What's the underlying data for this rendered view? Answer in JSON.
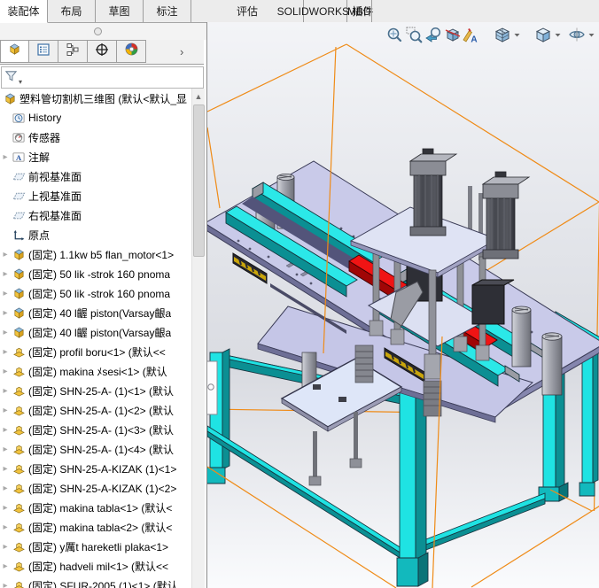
{
  "ribbon_tabs": [
    {
      "label": "装配体",
      "active": true
    },
    {
      "label": "布局",
      "active": false
    },
    {
      "label": "草图",
      "active": false
    },
    {
      "label": "标注",
      "active": false
    },
    {
      "label": "评估",
      "active": false
    },
    {
      "label": "SOLIDWORKS 插件",
      "active": false
    },
    {
      "label": "MBD",
      "active": false
    }
  ],
  "panel_tabs": [
    "featuremanager-design-tree",
    "propertymanager",
    "configurationmanager",
    "dimxpertmanager",
    "displaymanager"
  ],
  "filter": {
    "value": "",
    "placeholder": ""
  },
  "tree": {
    "root": {
      "icon": "assembly",
      "label": "塑料管切割机三维图  (默认<默认_显"
    },
    "items": [
      {
        "icon": "history",
        "arrow": false,
        "label": "History"
      },
      {
        "icon": "sensor",
        "arrow": false,
        "label": "传感器"
      },
      {
        "icon": "annotation",
        "arrow": true,
        "label": "注解"
      },
      {
        "icon": "plane",
        "arrow": false,
        "label": "前视基准面"
      },
      {
        "icon": "plane",
        "arrow": false,
        "label": "上视基准面"
      },
      {
        "icon": "plane",
        "arrow": false,
        "label": "右视基准面"
      },
      {
        "icon": "origin",
        "arrow": false,
        "label": "原点"
      },
      {
        "icon": "part-cube",
        "arrow": true,
        "label": "(固定) 1.1kw b5 flan_motor<1>"
      },
      {
        "icon": "part-cube",
        "arrow": true,
        "label": "(固定) 50 lik -strok 160 pnoma"
      },
      {
        "icon": "part-cube",
        "arrow": true,
        "label": "(固定) 50 lik -strok 160 pnoma"
      },
      {
        "icon": "part-cube",
        "arrow": true,
        "label": "(固定) 40 l齷 piston(Varsay齦a"
      },
      {
        "icon": "part-cube",
        "arrow": true,
        "label": "(固定) 40 l齷 piston(Varsay齦a"
      },
      {
        "icon": "part-block",
        "arrow": true,
        "label": "(固定) profil boru<1> (默认<<"
      },
      {
        "icon": "part-block",
        "arrow": true,
        "label": "(固定) makina ﾒsesi<1> (默认"
      },
      {
        "icon": "part-block",
        "arrow": true,
        "label": "(固定) SHN-25-A- (1)<1> (默认"
      },
      {
        "icon": "part-block",
        "arrow": true,
        "label": "(固定) SHN-25-A- (1)<2> (默认"
      },
      {
        "icon": "part-block",
        "arrow": true,
        "label": "(固定) SHN-25-A- (1)<3> (默认"
      },
      {
        "icon": "part-block",
        "arrow": true,
        "label": "(固定) SHN-25-A- (1)<4> (默认"
      },
      {
        "icon": "part-block",
        "arrow": true,
        "label": "(固定) SHN-25-A-KIZAK (1)<1>"
      },
      {
        "icon": "part-block",
        "arrow": true,
        "label": "(固定) SHN-25-A-KIZAK (1)<2>"
      },
      {
        "icon": "part-block",
        "arrow": true,
        "label": "(固定) makina tabla<1> (默认<"
      },
      {
        "icon": "part-block",
        "arrow": true,
        "label": "(固定) makina tabla<2> (默认<"
      },
      {
        "icon": "part-block",
        "arrow": true,
        "label": "(固定) y厲t hareketli plaka<1>"
      },
      {
        "icon": "part-block",
        "arrow": true,
        "label": "(固定) hadveli mil<1> (默认<<"
      },
      {
        "icon": "part-block",
        "arrow": true,
        "label": "(固定) SFUR-2005 (1)<1> (默认"
      }
    ]
  },
  "viewport_toolbar": [
    "zoom-to-fit",
    "zoom-to-area",
    "previous-view",
    "section-view",
    "edit-appearance",
    "view-orientation",
    "display-style",
    "hide-show-items"
  ],
  "colors": {
    "frame_cyan": "#1FE3E3",
    "frame_teal_dark": "#0B8F93",
    "table_lavender": "#C9CAE9",
    "selection_orange": "#EF8B17",
    "part_red": "#E31010",
    "metal_gray": "#A9ABB4"
  }
}
